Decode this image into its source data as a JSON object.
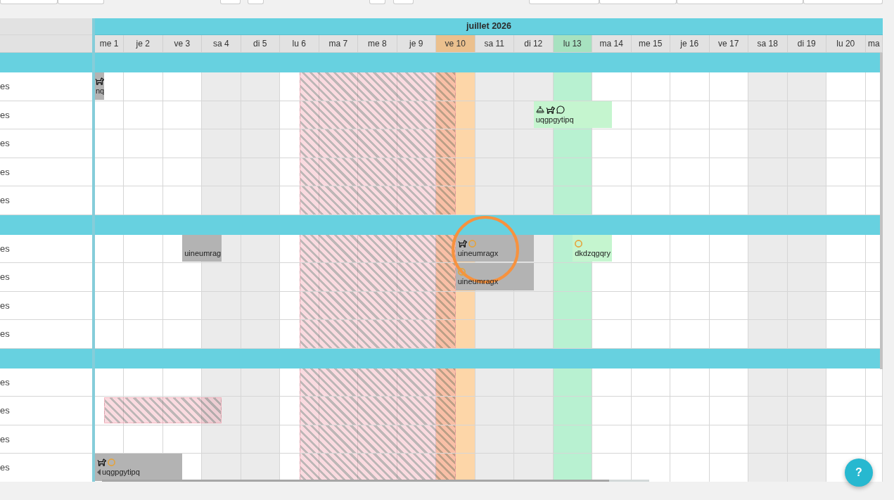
{
  "calendar": {
    "month": "juillet 2026",
    "days": [
      {
        "label": "me 1",
        "kind": "weekday"
      },
      {
        "label": "je 2",
        "kind": "weekday"
      },
      {
        "label": "ve 3",
        "kind": "weekday"
      },
      {
        "label": "sa 4",
        "kind": "weekend"
      },
      {
        "label": "di 5",
        "kind": "weekend"
      },
      {
        "label": "lu 6",
        "kind": "weekday"
      },
      {
        "label": "ma 7",
        "kind": "weekday"
      },
      {
        "label": "me 8",
        "kind": "weekday"
      },
      {
        "label": "je 9",
        "kind": "weekday"
      },
      {
        "label": "ve 10",
        "kind": "today"
      },
      {
        "label": "sa 11",
        "kind": "weekend"
      },
      {
        "label": "di 12",
        "kind": "weekend"
      },
      {
        "label": "lu 13",
        "kind": "marked"
      },
      {
        "label": "ma 14",
        "kind": "weekday"
      },
      {
        "label": "me 15",
        "kind": "weekday"
      },
      {
        "label": "je 16",
        "kind": "weekday"
      },
      {
        "label": "ve 17",
        "kind": "weekday"
      },
      {
        "label": "sa 18",
        "kind": "weekend"
      },
      {
        "label": "di 19",
        "kind": "weekend"
      },
      {
        "label": "lu 20",
        "kind": "weekday"
      },
      {
        "label": "ma",
        "kind": "weekday"
      }
    ],
    "closures": [
      {
        "kind": "unavailable"
      }
    ],
    "groups": [
      {
        "rows": [
          {
            "label": "es",
            "events": [
              {
                "kind": "booking",
                "color": "#b3b3b3",
                "label": "nq",
                "service": false,
                "pet": true,
                "comment": false,
                "pending": false,
                "continues_before": false
              }
            ]
          },
          {
            "label": "es",
            "events": [
              {
                "kind": "booking",
                "color": "#c5f5cf",
                "label": "uqgpgytipq",
                "service": true,
                "pet": true,
                "comment": true,
                "pending": false,
                "continues_before": false
              }
            ]
          },
          {
            "label": "es"
          },
          {
            "label": "es"
          },
          {
            "label": "es"
          }
        ]
      },
      {
        "rows": [
          {
            "label": "es",
            "events": [
              {
                "kind": "booking",
                "color": "#b3b3b3",
                "label": "uineumrag",
                "service": false,
                "pet": false,
                "comment": false,
                "pending": false,
                "continues_before": false
              },
              {
                "kind": "booking",
                "color": "#b3b3b3",
                "label": "uineumragx",
                "service": false,
                "pet": true,
                "comment": false,
                "pending": true,
                "continues_before": false
              },
              {
                "kind": "booking",
                "color": "#c5f5cf",
                "label": "dkdzqgqry",
                "service": false,
                "pet": false,
                "comment": false,
                "pending": true,
                "continues_before": false
              }
            ]
          },
          {
            "label": "es",
            "events": [
              {
                "kind": "booking",
                "color": "#b3b3b3",
                "label": "uineumragx",
                "service": false,
                "pet": false,
                "comment": false,
                "pending": true,
                "continues_before": false
              }
            ]
          },
          {
            "label": "es"
          },
          {
            "label": "es"
          }
        ]
      },
      {
        "rows": [
          {
            "label": "es"
          },
          {
            "label": "es",
            "events": [
              {
                "kind": "unavailable"
              }
            ]
          },
          {
            "label": "es"
          },
          {
            "label": "es",
            "events": [
              {
                "kind": "booking",
                "color": "#b3b3b3",
                "label": "uqgpgytipq",
                "service": false,
                "pet": true,
                "comment": false,
                "pending": true,
                "continues_before": true
              }
            ]
          }
        ]
      }
    ]
  },
  "help_button": {
    "label": "?"
  }
}
